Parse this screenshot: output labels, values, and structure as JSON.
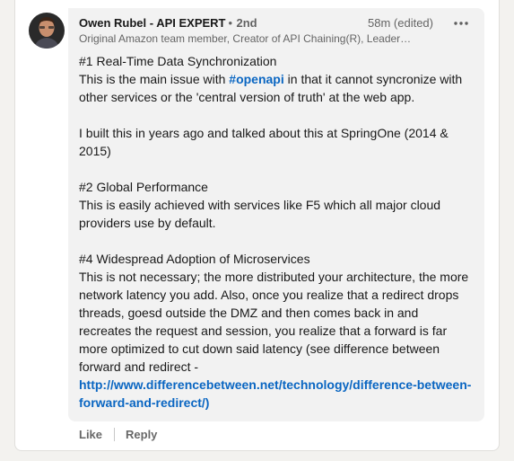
{
  "comment": {
    "author_name": "Owen Rubel - API EXPERT",
    "degree_separator": "•",
    "degree": "2nd",
    "timestamp": "58m (edited)",
    "headline": "Original Amazon team member, Creator of API Chaining(R), Leader…",
    "avatar_icon": "profile-photo",
    "more_icon": "ellipsis-icon",
    "paragraphs": [
      {
        "lines": [
          {
            "text": "#1 Real-Time Data Synchronization"
          },
          {
            "pre": "This is the main issue with ",
            "hashtag": "#openapi",
            "post": " in that it cannot syncronize with other services or the 'central version of truth' at the web app."
          }
        ]
      },
      {
        "lines": [
          {
            "text": "I built this in years ago and talked about this at SpringOne (2014 & 2015)"
          }
        ]
      },
      {
        "lines": [
          {
            "text": "#2 Global Performance"
          },
          {
            "text": "This is easily achieved with services like F5 which all major cloud providers use by default."
          }
        ]
      },
      {
        "lines": [
          {
            "text": "#4 Widespread Adoption of Microservices"
          },
          {
            "text": "This is not necessary; the more distributed your architecture, the more network latency you add. Also, once you realize that a redirect drops threads, goesd outside the DMZ and then comes back in and recreates the request and session, you realize that a forward is far more optimized to cut down said latency (see difference between forward and redirect -"
          },
          {
            "link": "http://www.differencebetween.net/technology/difference-between-forward-and-redirect/)"
          }
        ]
      }
    ]
  },
  "actions": {
    "like_label": "Like",
    "reply_label": "Reply"
  },
  "colors": {
    "link": "#0a66c2",
    "bubble_bg": "#f2f2f2",
    "page_bg": "#f3f2ef"
  }
}
